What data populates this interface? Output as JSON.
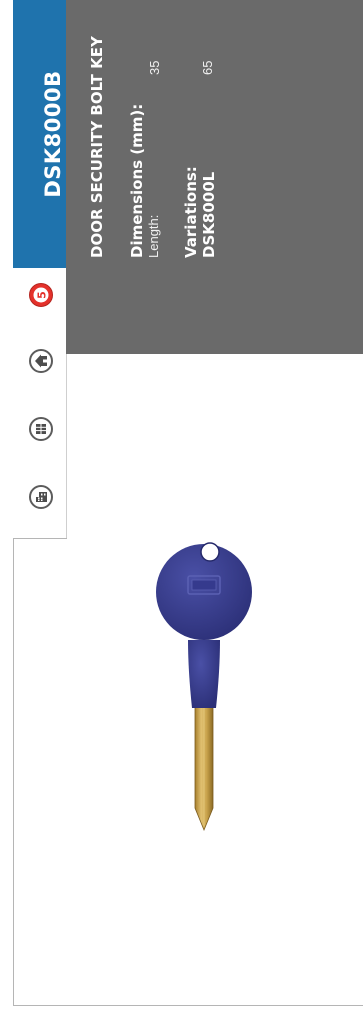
{
  "product": {
    "code": "DSK8000B",
    "title": "DOOR SECURITY BOLT KEY"
  },
  "dimensions": {
    "heading": "Dimensions (mm):",
    "length_label": "Length:",
    "length_value": "35"
  },
  "variations": {
    "heading": "Variations:",
    "items": [
      {
        "code": "DSK8000L",
        "length": "65"
      }
    ]
  },
  "icons": [
    {
      "name": "security-rating-icon",
      "color": "#e4312b"
    },
    {
      "name": "house-icon",
      "color": "#4d4d4d"
    },
    {
      "name": "window-grid-icon",
      "color": "#4d4d4d"
    },
    {
      "name": "building-icon",
      "color": "#4d4d4d"
    }
  ],
  "colors": {
    "code_band": "#1f73ad",
    "info_panel": "#6a6a6a",
    "key_head": "#3a3f8f",
    "key_shaft": "#c9a34c"
  }
}
